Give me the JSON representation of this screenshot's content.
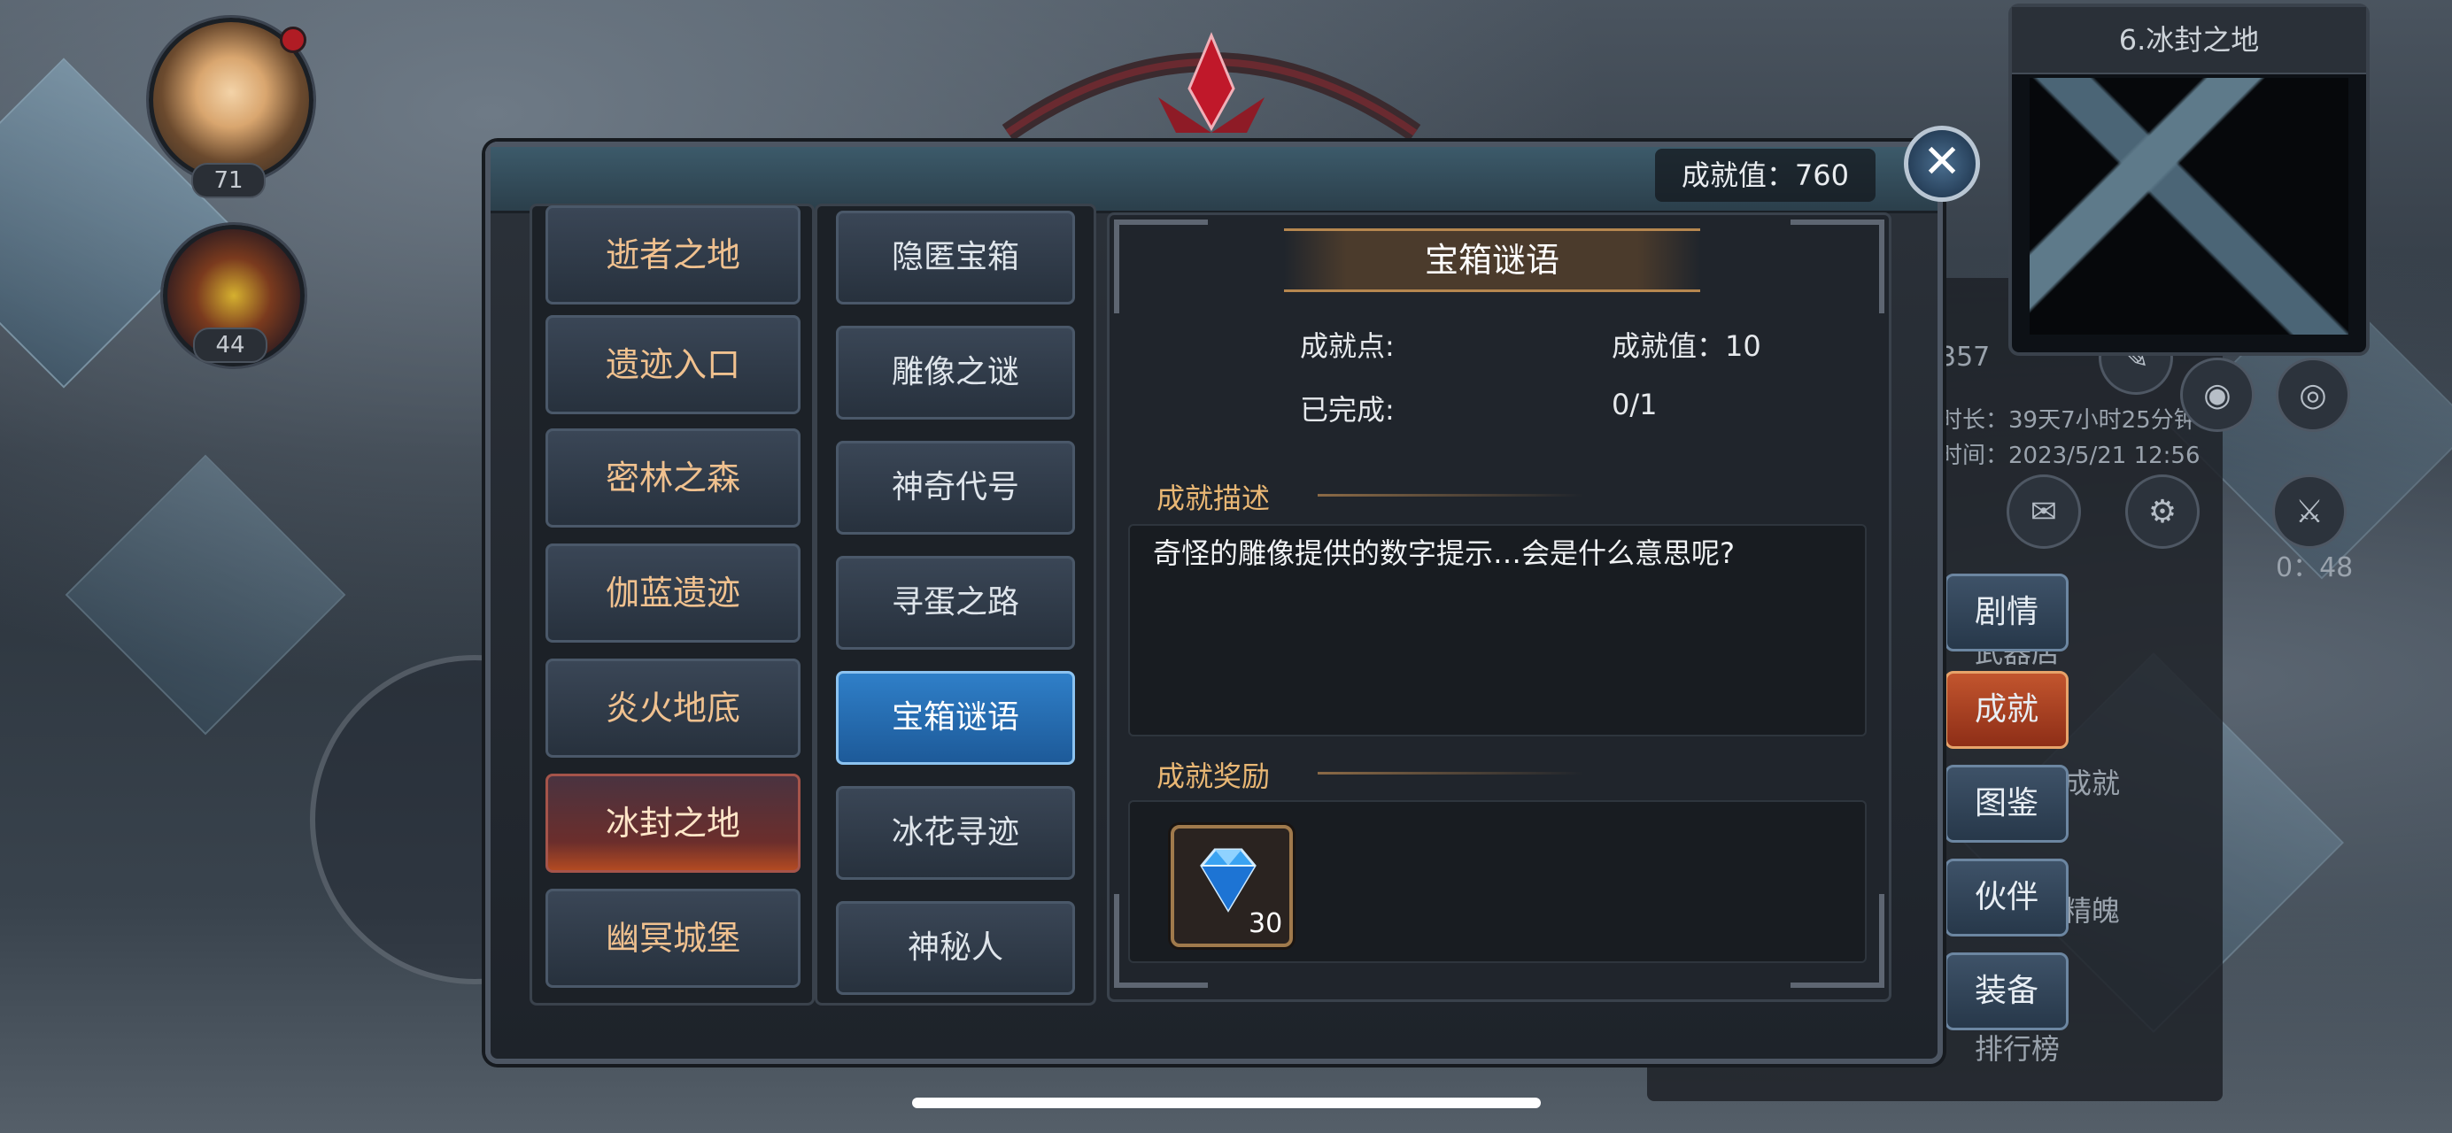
{
  "minimap": {
    "title": "6.冰封之地"
  },
  "player": {
    "level": "71"
  },
  "pet": {
    "level": "44"
  },
  "right_panel": {
    "partial_number": "357",
    "duration": "时长：39天7小时25分钟",
    "date": "时间：2023/5/21 12:56",
    "count": "0：48",
    "label_weapon": "武器店",
    "label_achievement": "成就",
    "label_soul": "精魄",
    "label_ranking": "排行榜"
  },
  "side_tabs": [
    {
      "label": "剧情"
    },
    {
      "label": "成就"
    },
    {
      "label": "图鉴"
    },
    {
      "label": "伙伴"
    },
    {
      "label": "装备"
    }
  ],
  "dialog": {
    "score_label": "成就值：760",
    "close_symbol": "✕",
    "regions": [
      {
        "label": "逝者之地"
      },
      {
        "label": "遗迹入口"
      },
      {
        "label": "密林之森"
      },
      {
        "label": "伽蓝遗迹"
      },
      {
        "label": "炎火地底"
      },
      {
        "label": "冰封之地"
      },
      {
        "label": "幽冥城堡"
      }
    ],
    "selected_region": "冰封之地",
    "achievements": [
      {
        "label": "隐匿宝箱"
      },
      {
        "label": "雕像之谜"
      },
      {
        "label": "神奇代号"
      },
      {
        "label": "寻蛋之路"
      },
      {
        "label": "宝箱谜语"
      },
      {
        "label": "冰花寻迹"
      },
      {
        "label": "神秘人"
      }
    ],
    "selected_achievement": "宝箱谜语",
    "detail": {
      "title": "宝箱谜语",
      "points_label": "成就点:",
      "points_value": "成就值：10",
      "completed_label": "已完成:",
      "completed_value": "0/1",
      "desc_header": "成就描述",
      "description": "奇怪的雕像提供的数字提示…会是什么意思呢?",
      "reward_header": "成就奖励",
      "reward_item": {
        "icon": "diamond-gem-icon",
        "quantity": "30"
      }
    }
  }
}
